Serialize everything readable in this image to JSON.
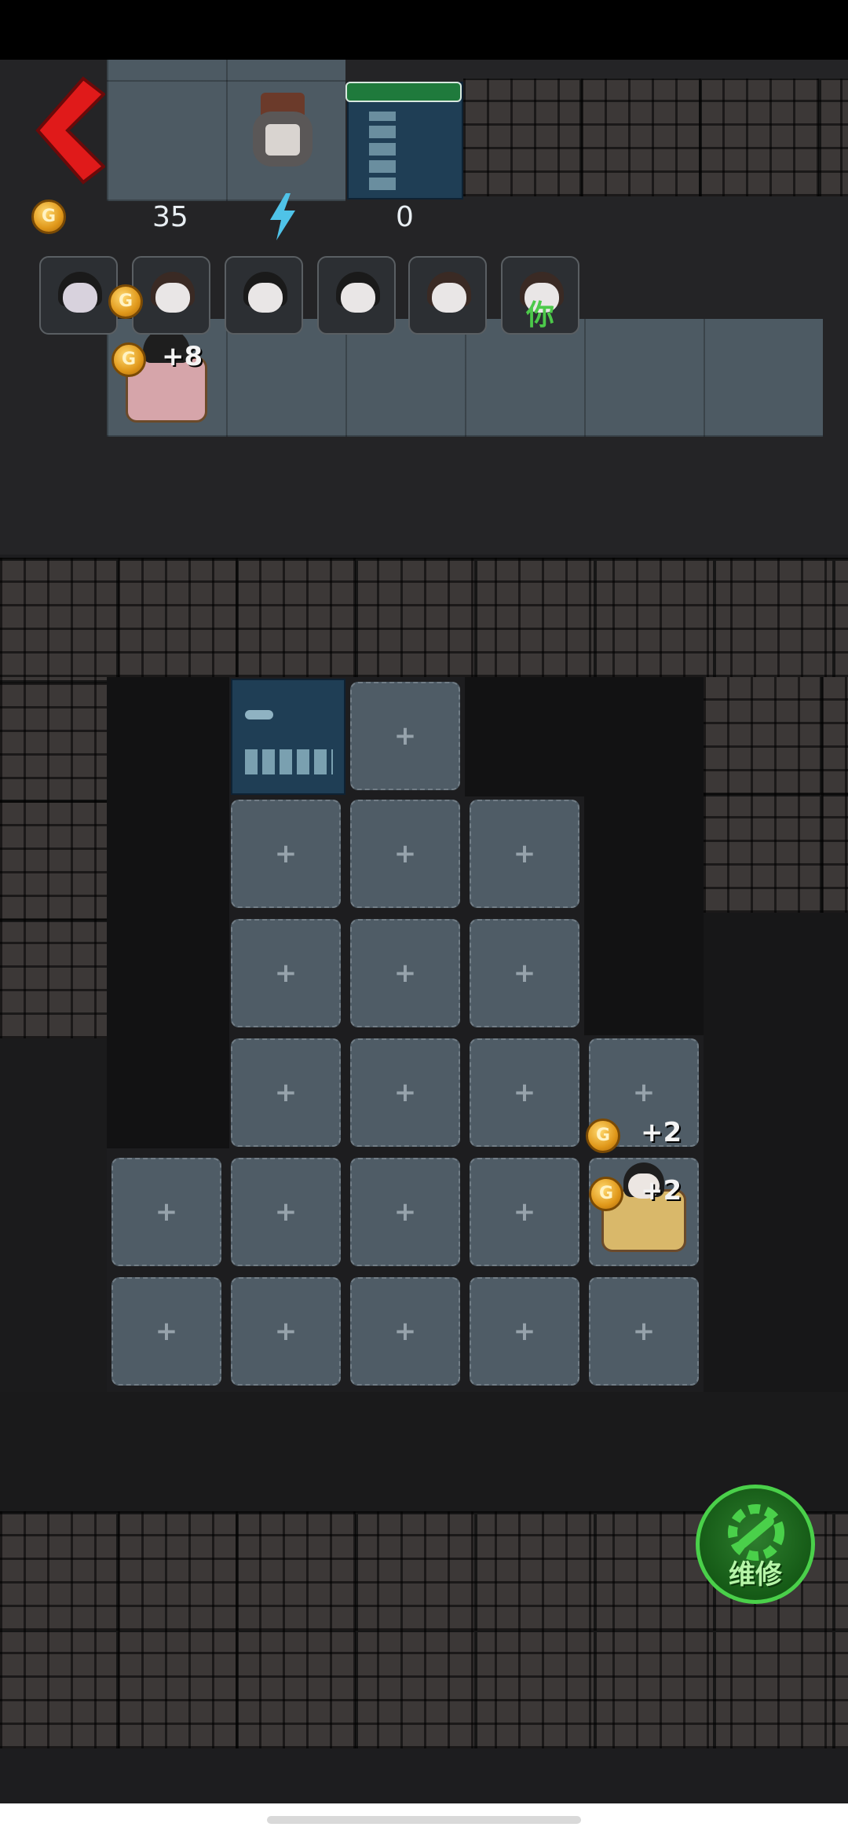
{
  "hud": {
    "gold": "35",
    "energy": "0",
    "gold_icon_letter": "G",
    "energy_icon": "lightning-icon",
    "back_icon": "chevron-left-icon"
  },
  "players": [
    {
      "name": "ghost-portrait"
    },
    {
      "name": "girl-portrait"
    },
    {
      "name": "bow-girl-portrait"
    },
    {
      "name": "boy-portrait"
    },
    {
      "name": "girl-portrait-2"
    },
    {
      "name": "you-portrait",
      "label": "你"
    }
  ],
  "floaters": {
    "top_bed_gain": "+8",
    "bed_gain_1": "+2",
    "bed_gain_2": "+2"
  },
  "repair_button": {
    "label": "维修"
  },
  "tile_glyph": "+",
  "colors": {
    "accent_green": "#4ad04a",
    "back_red": "#e01a1a",
    "door_blue": "#1f3e55"
  }
}
